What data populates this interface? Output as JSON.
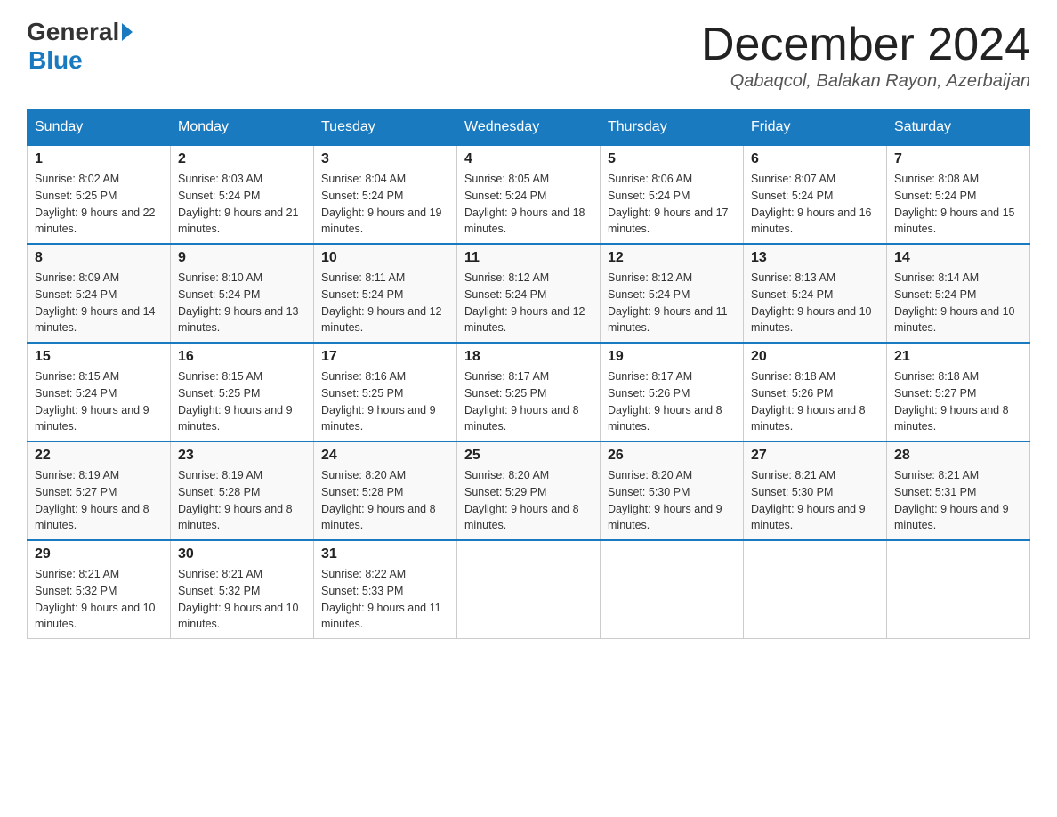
{
  "header": {
    "logo_general": "General",
    "logo_blue": "Blue",
    "month_title": "December 2024",
    "location": "Qabaqcol, Balakan Rayon, Azerbaijan"
  },
  "days_of_week": [
    "Sunday",
    "Monday",
    "Tuesday",
    "Wednesday",
    "Thursday",
    "Friday",
    "Saturday"
  ],
  "weeks": [
    [
      {
        "day": "1",
        "sunrise": "8:02 AM",
        "sunset": "5:25 PM",
        "daylight": "9 hours and 22 minutes."
      },
      {
        "day": "2",
        "sunrise": "8:03 AM",
        "sunset": "5:24 PM",
        "daylight": "9 hours and 21 minutes."
      },
      {
        "day": "3",
        "sunrise": "8:04 AM",
        "sunset": "5:24 PM",
        "daylight": "9 hours and 19 minutes."
      },
      {
        "day": "4",
        "sunrise": "8:05 AM",
        "sunset": "5:24 PM",
        "daylight": "9 hours and 18 minutes."
      },
      {
        "day": "5",
        "sunrise": "8:06 AM",
        "sunset": "5:24 PM",
        "daylight": "9 hours and 17 minutes."
      },
      {
        "day": "6",
        "sunrise": "8:07 AM",
        "sunset": "5:24 PM",
        "daylight": "9 hours and 16 minutes."
      },
      {
        "day": "7",
        "sunrise": "8:08 AM",
        "sunset": "5:24 PM",
        "daylight": "9 hours and 15 minutes."
      }
    ],
    [
      {
        "day": "8",
        "sunrise": "8:09 AM",
        "sunset": "5:24 PM",
        "daylight": "9 hours and 14 minutes."
      },
      {
        "day": "9",
        "sunrise": "8:10 AM",
        "sunset": "5:24 PM",
        "daylight": "9 hours and 13 minutes."
      },
      {
        "day": "10",
        "sunrise": "8:11 AM",
        "sunset": "5:24 PM",
        "daylight": "9 hours and 12 minutes."
      },
      {
        "day": "11",
        "sunrise": "8:12 AM",
        "sunset": "5:24 PM",
        "daylight": "9 hours and 12 minutes."
      },
      {
        "day": "12",
        "sunrise": "8:12 AM",
        "sunset": "5:24 PM",
        "daylight": "9 hours and 11 minutes."
      },
      {
        "day": "13",
        "sunrise": "8:13 AM",
        "sunset": "5:24 PM",
        "daylight": "9 hours and 10 minutes."
      },
      {
        "day": "14",
        "sunrise": "8:14 AM",
        "sunset": "5:24 PM",
        "daylight": "9 hours and 10 minutes."
      }
    ],
    [
      {
        "day": "15",
        "sunrise": "8:15 AM",
        "sunset": "5:24 PM",
        "daylight": "9 hours and 9 minutes."
      },
      {
        "day": "16",
        "sunrise": "8:15 AM",
        "sunset": "5:25 PM",
        "daylight": "9 hours and 9 minutes."
      },
      {
        "day": "17",
        "sunrise": "8:16 AM",
        "sunset": "5:25 PM",
        "daylight": "9 hours and 9 minutes."
      },
      {
        "day": "18",
        "sunrise": "8:17 AM",
        "sunset": "5:25 PM",
        "daylight": "9 hours and 8 minutes."
      },
      {
        "day": "19",
        "sunrise": "8:17 AM",
        "sunset": "5:26 PM",
        "daylight": "9 hours and 8 minutes."
      },
      {
        "day": "20",
        "sunrise": "8:18 AM",
        "sunset": "5:26 PM",
        "daylight": "9 hours and 8 minutes."
      },
      {
        "day": "21",
        "sunrise": "8:18 AM",
        "sunset": "5:27 PM",
        "daylight": "9 hours and 8 minutes."
      }
    ],
    [
      {
        "day": "22",
        "sunrise": "8:19 AM",
        "sunset": "5:27 PM",
        "daylight": "9 hours and 8 minutes."
      },
      {
        "day": "23",
        "sunrise": "8:19 AM",
        "sunset": "5:28 PM",
        "daylight": "9 hours and 8 minutes."
      },
      {
        "day": "24",
        "sunrise": "8:20 AM",
        "sunset": "5:28 PM",
        "daylight": "9 hours and 8 minutes."
      },
      {
        "day": "25",
        "sunrise": "8:20 AM",
        "sunset": "5:29 PM",
        "daylight": "9 hours and 8 minutes."
      },
      {
        "day": "26",
        "sunrise": "8:20 AM",
        "sunset": "5:30 PM",
        "daylight": "9 hours and 9 minutes."
      },
      {
        "day": "27",
        "sunrise": "8:21 AM",
        "sunset": "5:30 PM",
        "daylight": "9 hours and 9 minutes."
      },
      {
        "day": "28",
        "sunrise": "8:21 AM",
        "sunset": "5:31 PM",
        "daylight": "9 hours and 9 minutes."
      }
    ],
    [
      {
        "day": "29",
        "sunrise": "8:21 AM",
        "sunset": "5:32 PM",
        "daylight": "9 hours and 10 minutes."
      },
      {
        "day": "30",
        "sunrise": "8:21 AM",
        "sunset": "5:32 PM",
        "daylight": "9 hours and 10 minutes."
      },
      {
        "day": "31",
        "sunrise": "8:22 AM",
        "sunset": "5:33 PM",
        "daylight": "9 hours and 11 minutes."
      },
      null,
      null,
      null,
      null
    ]
  ],
  "labels": {
    "sunrise_prefix": "Sunrise: ",
    "sunset_prefix": "Sunset: ",
    "daylight_prefix": "Daylight: "
  }
}
